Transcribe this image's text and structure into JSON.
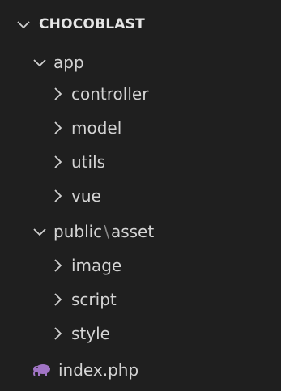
{
  "explorer": {
    "section_title": "CHOCOBLAST",
    "tree": {
      "app": {
        "label": "app",
        "children": [
          "controller",
          "model",
          "utils",
          "vue"
        ]
      },
      "public": {
        "label_part1": "public",
        "separator": "\\",
        "label_part2": "asset",
        "children": [
          "image",
          "script",
          "style"
        ]
      },
      "file": {
        "label": "index.php",
        "icon": "php-elephant-icon",
        "icon_color": "#a074c4"
      }
    }
  }
}
